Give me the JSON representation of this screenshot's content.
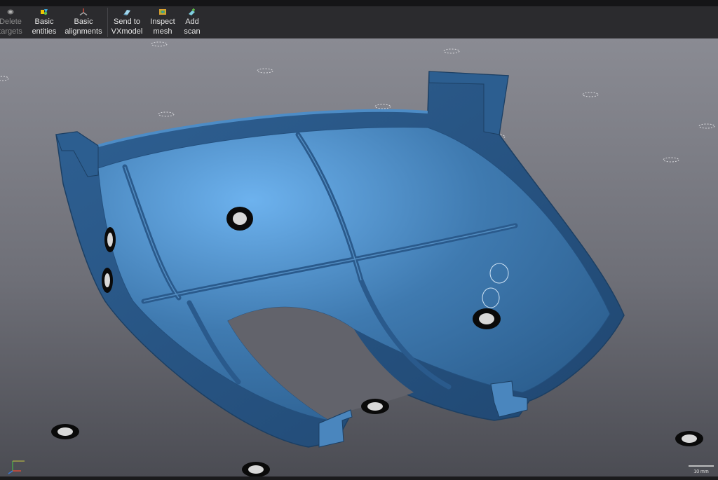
{
  "toolbar": {
    "buttons": [
      {
        "line1": "Delete",
        "line2": "targets",
        "icon": "delete-targets-icon",
        "enabled": false
      },
      {
        "line1": "Basic",
        "line2": "entities",
        "icon": "basic-entities-icon",
        "enabled": true
      },
      {
        "line1": "Basic",
        "line2": "alignments",
        "icon": "basic-alignments-icon",
        "enabled": true
      },
      {
        "line1": "Send to",
        "line2": "VXmodel",
        "icon": "send-to-vxmodel-icon",
        "enabled": true
      },
      {
        "line1": "Inspect",
        "line2": "mesh",
        "icon": "inspect-mesh-icon",
        "enabled": true
      },
      {
        "line1": "Add",
        "line2": "scan",
        "icon": "add-scan-icon",
        "enabled": true
      }
    ]
  },
  "viewport": {
    "part_color": "#3f7ab0",
    "background_top": "#8a8b93",
    "background_bottom": "#4b4c53",
    "scale_bar_label": "10 mm"
  },
  "colors": {
    "toolbar_bg": "#2b2b2e",
    "text": "#e6e6e6",
    "disabled_text": "#8a8a8a"
  }
}
